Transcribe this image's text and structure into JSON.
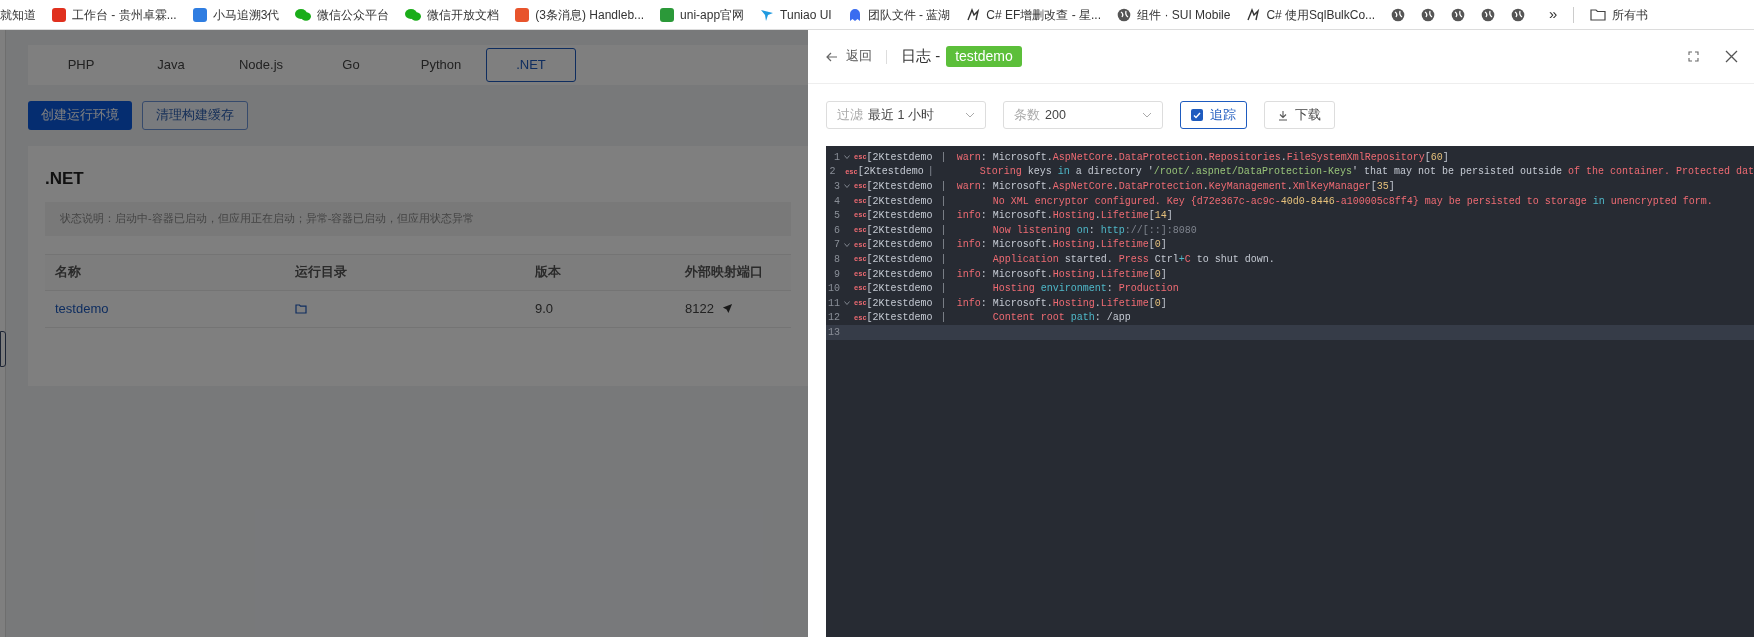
{
  "bookmarks": [
    {
      "label": "就知道",
      "kind": "text"
    },
    {
      "label": "工作台 - 贵州卓霖...",
      "kind": "redsquare"
    },
    {
      "label": "小马追溯3代",
      "kind": "bluesquare"
    },
    {
      "label": "微信公众平台",
      "kind": "chat"
    },
    {
      "label": "微信开放文档",
      "kind": "chat"
    },
    {
      "label": "(3条消息) Handleb...",
      "kind": "orangesquare"
    },
    {
      "label": "uni-app官网",
      "kind": "greensquare"
    },
    {
      "label": "Tuniao UI",
      "kind": "bird"
    },
    {
      "label": "团队文件 - 蓝湖",
      "kind": "ghost"
    },
    {
      "label": "C# EF增删改查 - 星...",
      "kind": "feather"
    },
    {
      "label": "组件 · SUI Mobile",
      "kind": "globe"
    },
    {
      "label": "C# 使用SqlBulkCo...",
      "kind": "feather"
    },
    {
      "kind": "globe"
    },
    {
      "kind": "globe"
    },
    {
      "kind": "globe"
    },
    {
      "kind": "globe"
    },
    {
      "kind": "globe"
    }
  ],
  "bookmarks_more": "»",
  "bookmarks_folder": "所有书",
  "tabs": [
    {
      "label": "PHP",
      "selected": false
    },
    {
      "label": "Java",
      "selected": false
    },
    {
      "label": "Node.js",
      "selected": false
    },
    {
      "label": "Go",
      "selected": false
    },
    {
      "label": "Python",
      "selected": false
    },
    {
      "label": ".NET",
      "selected": true
    }
  ],
  "actions": [
    {
      "label": "创建运行环境",
      "kind": "primary"
    },
    {
      "label": "清理构建缓存",
      "kind": "outline"
    }
  ],
  "panel": {
    "title": ".NET",
    "notice": "状态说明：启动中-容器已启动，但应用正在启动；异常-容器已启动，但应用状态异常",
    "columns": [
      "名称",
      "运行目录",
      "版本",
      "外部映射端口"
    ],
    "rows": [
      {
        "name": "testdemo",
        "version": "9.0",
        "port": "8122"
      }
    ]
  },
  "drawer": {
    "back": "返回",
    "title": "日志 -",
    "tag": "testdemo",
    "filter": {
      "label": "过滤",
      "value": "最近 1 小时"
    },
    "count": {
      "label": "条数",
      "value": "200"
    },
    "follow": {
      "label": "追踪",
      "checked": true
    },
    "download": "下载",
    "lines": [
      {
        "no": "1",
        "fold": true,
        "current": false,
        "esc": "esc",
        "source": "[2Ktestdemo",
        "sep": "|",
        "segments": [
          {
            "t": " warn",
            "kind": "kw"
          },
          {
            "t": ": Microsoft.",
            "kind": "text"
          },
          {
            "t": "AspNetCore",
            "kind": "kw"
          },
          {
            "t": ".",
            "kind": "text"
          },
          {
            "t": "DataProtection",
            "kind": "kw"
          },
          {
            "t": ".",
            "kind": "text"
          },
          {
            "t": "Repositories",
            "kind": "kw"
          },
          {
            "t": ".",
            "kind": "text"
          },
          {
            "t": "FileSystemXmlRepository",
            "kind": "kw"
          },
          {
            "t": "[",
            "kind": "text"
          },
          {
            "t": "60",
            "kind": "num"
          },
          {
            "t": "]",
            "kind": "text"
          }
        ]
      },
      {
        "no": "2",
        "fold": false,
        "current": false,
        "esc": "esc",
        "source": "[2Ktestdemo",
        "sep": "|",
        "segments": [
          {
            "t": "       Storing",
            "kind": "kw"
          },
          {
            "t": " keys ",
            "kind": "text"
          },
          {
            "t": "in",
            "kind": "type"
          },
          {
            "t": " a directory '",
            "kind": "text"
          },
          {
            "t": "/root/.aspnet/DataProtection-Keys",
            "kind": "str"
          },
          {
            "t": "' that may not be persisted outside ",
            "kind": "text"
          },
          {
            "t": "of the container. Protected dat",
            "kind": "kw"
          }
        ]
      },
      {
        "no": "3",
        "fold": true,
        "current": false,
        "esc": "esc",
        "source": "[2Ktestdemo",
        "sep": "|",
        "segments": [
          {
            "t": " warn",
            "kind": "kw"
          },
          {
            "t": ": Microsoft.",
            "kind": "text"
          },
          {
            "t": "AspNetCore",
            "kind": "kw"
          },
          {
            "t": ".",
            "kind": "text"
          },
          {
            "t": "DataProtection",
            "kind": "kw"
          },
          {
            "t": ".",
            "kind": "text"
          },
          {
            "t": "KeyManagement",
            "kind": "kw"
          },
          {
            "t": ".",
            "kind": "text"
          },
          {
            "t": "XmlKeyManager",
            "kind": "kw"
          },
          {
            "t": "[",
            "kind": "text"
          },
          {
            "t": "35",
            "kind": "num"
          },
          {
            "t": "]",
            "kind": "text"
          }
        ]
      },
      {
        "no": "4",
        "fold": false,
        "current": false,
        "esc": "esc",
        "source": "[2Ktestdemo",
        "sep": "|",
        "segments": [
          {
            "t": "       No XML encryptor configured. Key {d72e367c-ac9c-",
            "kind": "kw"
          },
          {
            "t": "40d0-8446",
            "kind": "num"
          },
          {
            "t": "-a100005c8ff4} may be persisted to storage ",
            "kind": "kw"
          },
          {
            "t": "in",
            "kind": "type"
          },
          {
            "t": " unencrypted form.",
            "kind": "kw"
          }
        ]
      },
      {
        "no": "5",
        "fold": false,
        "current": false,
        "esc": "esc",
        "source": "[2Ktestdemo",
        "sep": "|",
        "segments": [
          {
            "t": " info",
            "kind": "kw"
          },
          {
            "t": ": Microsoft.",
            "kind": "text"
          },
          {
            "t": "Hosting",
            "kind": "kw"
          },
          {
            "t": ".",
            "kind": "text"
          },
          {
            "t": "Lifetime",
            "kind": "kw"
          },
          {
            "t": "[",
            "kind": "text"
          },
          {
            "t": "14",
            "kind": "num"
          },
          {
            "t": "]",
            "kind": "text"
          }
        ]
      },
      {
        "no": "6",
        "fold": false,
        "current": false,
        "esc": "esc",
        "source": "[2Ktestdemo",
        "sep": "|",
        "segments": [
          {
            "t": "       Now listening",
            "kind": "kw"
          },
          {
            "t": " on",
            "kind": "type"
          },
          {
            "t": ": ",
            "kind": "text"
          },
          {
            "t": "http",
            "kind": "type"
          },
          {
            "t": "://[::]:8080",
            "kind": "dim"
          }
        ]
      },
      {
        "no": "7",
        "fold": true,
        "current": false,
        "esc": "esc",
        "source": "[2Ktestdemo",
        "sep": "|",
        "segments": [
          {
            "t": " info",
            "kind": "kw"
          },
          {
            "t": ": Microsoft.",
            "kind": "text"
          },
          {
            "t": "Hosting",
            "kind": "kw"
          },
          {
            "t": ".",
            "kind": "text"
          },
          {
            "t": "Lifetime",
            "kind": "kw"
          },
          {
            "t": "[",
            "kind": "text"
          },
          {
            "t": "0",
            "kind": "num"
          },
          {
            "t": "]",
            "kind": "text"
          }
        ]
      },
      {
        "no": "8",
        "fold": false,
        "current": false,
        "esc": "esc",
        "source": "[2Ktestdemo",
        "sep": "|",
        "segments": [
          {
            "t": "       Application",
            "kind": "kw"
          },
          {
            "t": " started. ",
            "kind": "text"
          },
          {
            "t": "Press",
            "kind": "kw"
          },
          {
            "t": " Ctrl",
            "kind": "text"
          },
          {
            "t": "+",
            "kind": "type"
          },
          {
            "t": "C",
            "kind": "kw"
          },
          {
            "t": " to shut down.",
            "kind": "text"
          }
        ]
      },
      {
        "no": "9",
        "fold": false,
        "current": false,
        "esc": "esc",
        "source": "[2Ktestdemo",
        "sep": "|",
        "segments": [
          {
            "t": " info",
            "kind": "kw"
          },
          {
            "t": ": Microsoft.",
            "kind": "text"
          },
          {
            "t": "Hosting",
            "kind": "kw"
          },
          {
            "t": ".",
            "kind": "text"
          },
          {
            "t": "Lifetime",
            "kind": "kw"
          },
          {
            "t": "[",
            "kind": "text"
          },
          {
            "t": "0",
            "kind": "num"
          },
          {
            "t": "]",
            "kind": "text"
          }
        ]
      },
      {
        "no": "10",
        "fold": false,
        "current": false,
        "esc": "esc",
        "source": "[2Ktestdemo",
        "sep": "|",
        "segments": [
          {
            "t": "       Hosting",
            "kind": "kw"
          },
          {
            "t": " environment",
            "kind": "type"
          },
          {
            "t": ": ",
            "kind": "text"
          },
          {
            "t": "Production",
            "kind": "kw"
          }
        ]
      },
      {
        "no": "11",
        "fold": true,
        "current": false,
        "esc": "esc",
        "source": "[2Ktestdemo",
        "sep": "|",
        "segments": [
          {
            "t": " info",
            "kind": "kw"
          },
          {
            "t": ": Microsoft.",
            "kind": "text"
          },
          {
            "t": "Hosting",
            "kind": "kw"
          },
          {
            "t": ".",
            "kind": "text"
          },
          {
            "t": "Lifetime",
            "kind": "kw"
          },
          {
            "t": "[",
            "kind": "text"
          },
          {
            "t": "0",
            "kind": "num"
          },
          {
            "t": "]",
            "kind": "text"
          }
        ]
      },
      {
        "no": "12",
        "fold": false,
        "current": false,
        "esc": "esc",
        "source": "[2Ktestdemo",
        "sep": "|",
        "segments": [
          {
            "t": "       Content root",
            "kind": "kw"
          },
          {
            "t": " path",
            "kind": "type"
          },
          {
            "t": ": /app",
            "kind": "text"
          }
        ]
      },
      {
        "no": "13",
        "fold": false,
        "current": true
      }
    ]
  }
}
